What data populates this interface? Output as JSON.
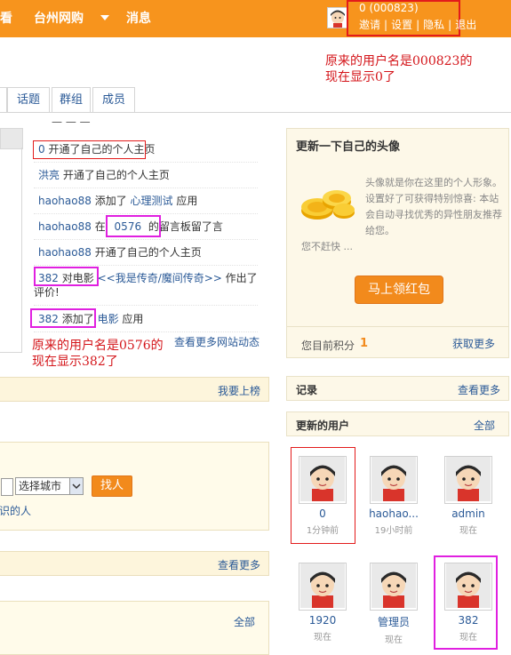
{
  "topbar": {
    "nav_partial": "看",
    "nav_site": "台州网购",
    "nav_messages": "消息",
    "username_display": "0 (000823)",
    "links": [
      "邀请",
      "设置",
      "隐私",
      "退出"
    ]
  },
  "notes": {
    "top_line1": "原来的用户名是000823的",
    "top_line2": "现在显示0了",
    "mid_line1": "原来的用户名是0576的",
    "mid_line2": "现在显示382了"
  },
  "tabs": [
    "话题",
    "群组",
    "成员"
  ],
  "feed": [
    {
      "user": "0",
      "text": "开通了自己的个人主页"
    },
    {
      "user": "洪亮",
      "text": "开通了自己的个人主页"
    },
    {
      "user": "haohao88",
      "text": "添加了",
      "app": "心理测试",
      "suffix": "应用"
    },
    {
      "user": "haohao88",
      "text": "在",
      "target": "0576",
      "suffix": "的留言板留了言"
    },
    {
      "user": "haohao88",
      "text": "开通了自己的个人主页"
    },
    {
      "user": "382",
      "text": "对电影",
      "link": "<<我是传奇/魔间传奇>>",
      "suffix": "作出了评价!"
    },
    {
      "user": "382",
      "text": "添加了",
      "app": "电影",
      "suffix": "应用"
    }
  ],
  "feed_more": "查看更多网站动态",
  "left_section": {
    "rank_link": "我要上榜",
    "select_city": "选择城市",
    "find_button": "找人",
    "partial_text": "识的人",
    "view_more": "查看更多",
    "all_link": "全部"
  },
  "avatar_panel": {
    "title": "更新一下自己的头像",
    "desc": "头像就是你在这里的个人形象。 设置好了可获得特别惊喜: 本站会自动寻找优秀的异性朋友推荐给您。",
    "desc_tail": "您不赶快 ...",
    "button": "马上领红包",
    "points_label": "您目前积分",
    "points_value": "1",
    "earn_more": "获取更多"
  },
  "records": {
    "title": "记录",
    "more": "查看更多"
  },
  "updated_users": {
    "title": "更新的用户",
    "all": "全部",
    "users": [
      {
        "name": "0",
        "time": "1分钟前"
      },
      {
        "name": "haohao...",
        "time": "19小时前"
      },
      {
        "name": "admin",
        "time": "现在"
      },
      {
        "name": "1920",
        "time": "现在"
      },
      {
        "name": "管理员",
        "time": "现在"
      },
      {
        "name": "382",
        "time": "现在"
      }
    ]
  },
  "icons": {
    "avatar": "cartoon-avatar-icon",
    "coins": "gold-coins-icon",
    "dropdown": "chevron-down-icon"
  },
  "colors": {
    "topbar": "#f7941d",
    "annotation_red": "#e31b1b",
    "annotation_magenta": "#e020e0",
    "link": "#2b5a97"
  }
}
